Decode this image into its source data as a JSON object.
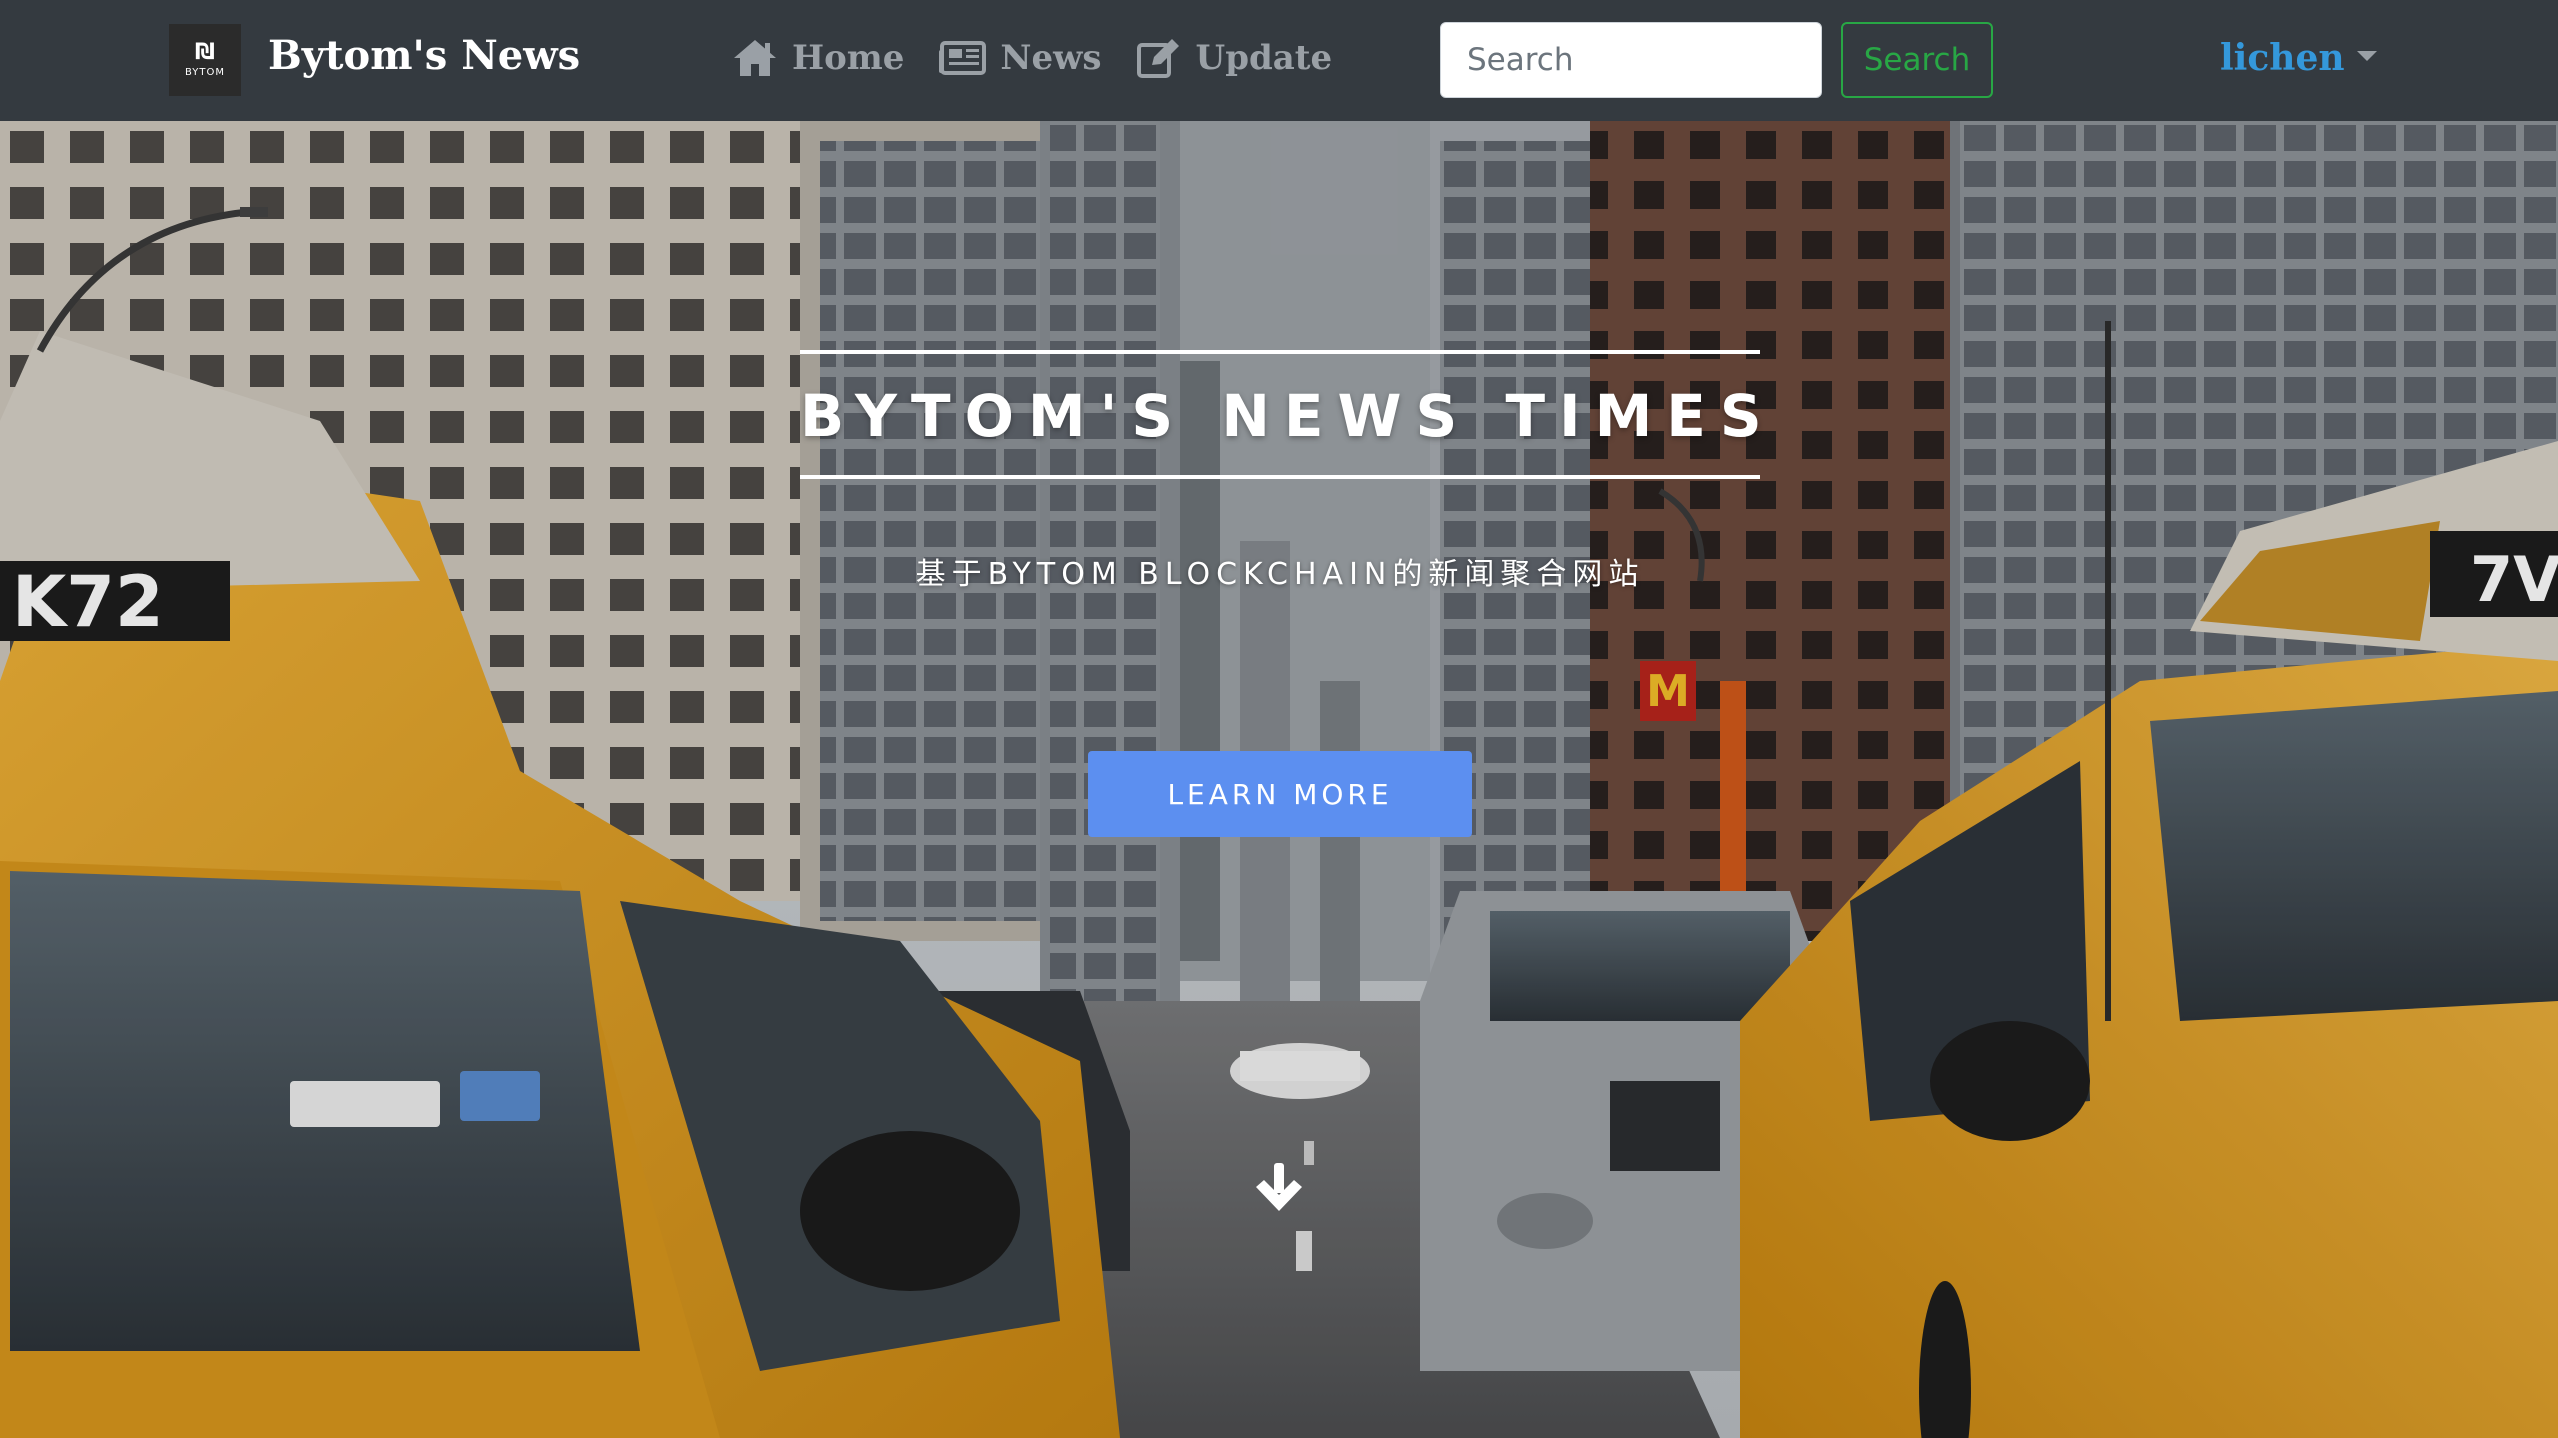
{
  "navbar": {
    "logo_glyph": "₪",
    "logo_text": "BYTOM",
    "brand": "Bytom's News",
    "links": [
      {
        "label": "Home",
        "icon": "home-icon"
      },
      {
        "label": "News",
        "icon": "newspaper-icon"
      },
      {
        "label": "Update",
        "icon": "edit-icon"
      }
    ],
    "search": {
      "placeholder": "Search",
      "value": "",
      "button_label": "Search"
    },
    "user": {
      "name": "lichen",
      "icon": "caret-down-icon"
    }
  },
  "hero": {
    "title": "BYTOM'S NEWS TIMES",
    "subtitle": "基于BYTOM BLOCKCHAIN的新闻聚合网站",
    "button_label": "LEARN MORE",
    "scroll_icon": "arrow-down-icon"
  },
  "colors": {
    "navbar_bg": "#343a40",
    "nav_link": "#9aa0a6",
    "user_link": "#3498db",
    "search_button": "#28a745",
    "primary_button": "#5c8ff0",
    "taxi_yellow": "#e7a521"
  }
}
